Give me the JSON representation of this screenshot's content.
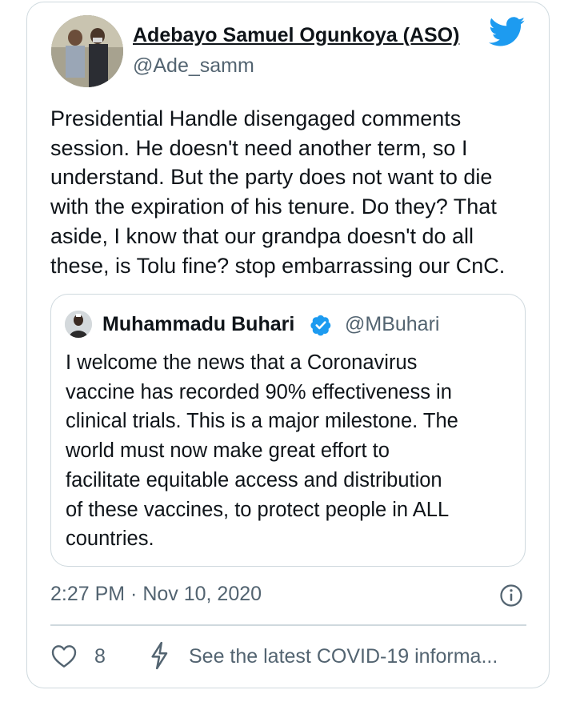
{
  "author": {
    "display_name": "Adebayo Samuel Ogunkoya (ASO)",
    "handle": "@Ade_samm"
  },
  "tweet": {
    "lines": [
      "Presidential Handle disengaged comments",
      "session. He doesn't need another term, so I",
      "understand. But the party does not want to die",
      "with the expiration of his tenure. Do they? That",
      "aside, I know that our grandpa doesn't do all",
      "these, is Tolu fine? stop embarrassing our CnC."
    ]
  },
  "quoted_tweet": {
    "display_name": "Muhammadu Buhari",
    "handle": "@MBuhari",
    "verified": true,
    "lines": [
      "I welcome the news that a Coronavirus",
      "vaccine has recorded 90% effectiveness in",
      "clinical trials. This is a major milestone. The",
      "world must now make great effort to",
      "facilitate equitable access and distribution",
      "of these vaccines, to protect people in ALL",
      "countries."
    ]
  },
  "timestamp": "2:27 PM · Nov 10, 2020",
  "actions": {
    "like_count": "8",
    "covid_link": "See the latest COVID-19 informa..."
  },
  "icons": {
    "logo": "twitter-bird-icon",
    "verified": "verified-badge-icon",
    "info": "info-icon",
    "like": "heart-icon",
    "covid": "lightning-bolt-icon"
  },
  "colors": {
    "brand_blue": "#1d9bf0",
    "text_primary": "#0f1419",
    "text_secondary": "#536471",
    "border": "#cfd9de"
  }
}
